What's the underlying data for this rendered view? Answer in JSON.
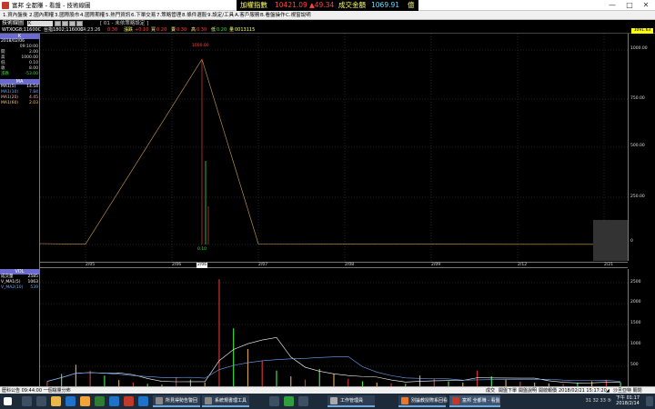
{
  "window": {
    "title": "富邦 全都賺 - 看盤 - 技術線圖",
    "controls": [
      "—",
      "□",
      "✕"
    ]
  },
  "ticker": {
    "index_label": "加權指數",
    "index_value": "10421.09",
    "change": "▲49.34",
    "turnover_label": "成交金額",
    "turnover_value": "1069.91",
    "unit": "億"
  },
  "menu": [
    "1.資內盤後",
    "2.國內期權",
    "3.國際股市",
    "4.國際期權",
    "5.熱門資訊",
    "6.下單交易",
    "7.策略管理",
    "8.條件選股",
    "9.設定/工具",
    "A.客戶服務",
    "B.看盤操作",
    "C.視窗說明"
  ],
  "toolbar": {
    "label": "技術線圖",
    "combo": "K",
    "strategy": "[ 01 - 未依策略設定 ]"
  },
  "infobar": {
    "symbol": "WTXOG8;11600C",
    "name": "台指1802;11600C",
    "time": "04:23:26",
    "price": "0.30",
    "change_label": "漲跌",
    "change": "+0.10",
    "bid_label": "買",
    "bid": "0.20",
    "ask_label": "賣",
    "ask": "0.30",
    "high_label": "高",
    "high": "0.30",
    "low_label": "低",
    "low": "0.20",
    "vol_label": "量",
    "vol": "0013115",
    "price_tag": "1091.63"
  },
  "left_panel": {
    "k_header": "K",
    "date": "2018/02/06",
    "time": "09:10:00",
    "rows": [
      {
        "label": "開",
        "value": "2.00"
      },
      {
        "label": "高",
        "value": "1000.00"
      },
      {
        "label": "低",
        "value": "0.10"
      },
      {
        "label": "收",
        "value": "8.00"
      },
      {
        "label": "漲跌",
        "value": "-53.00"
      }
    ],
    "ma_header": "MA",
    "ma_rows": [
      {
        "label": "MA1(5)",
        "value": "14.54",
        "color": "#ffffff"
      },
      {
        "label": "MA1(10)",
        "value": "7.84",
        "color": "#6fa8ff"
      },
      {
        "label": "MA1(20)",
        "value": "4.45",
        "color": "#ffaaaa"
      },
      {
        "label": "MA1(60)",
        "value": "2.03",
        "color": "#ffcc66"
      }
    ],
    "vol_header": "VOL",
    "vol_rows": [
      {
        "label": "成交量",
        "value": "2585",
        "color": "#ffffff"
      },
      {
        "label": "V_MA1(5)",
        "value": "1063",
        "color": "#ffffff"
      },
      {
        "label": "V_MA2(10)",
        "value": "539",
        "color": "#6fa8ff"
      }
    ]
  },
  "main_axis": [
    "1000.00",
    "750.00",
    "500.00",
    "250.00",
    "0"
  ],
  "spike_label": "1000.00",
  "low_label": "0.10",
  "dates": [
    "2/05",
    "2/06",
    "2/06",
    "2/07",
    "2/08",
    "2/09",
    "2/12",
    "2/21"
  ],
  "vol_axis": [
    "2500",
    "2000",
    "1500",
    "1000",
    "500"
  ],
  "chart_data": [
    {
      "type": "line",
      "title": "",
      "x": [
        "2/05",
        "2/06",
        "2/07",
        "2/08",
        "2/09",
        "2/12",
        "2/21"
      ],
      "ylim": [
        0,
        1050
      ],
      "series": [
        {
          "values": [
            2,
            1000,
            3,
            2,
            2,
            1,
            1
          ]
        }
      ]
    },
    {
      "type": "bar",
      "title": "",
      "ylim": [
        0,
        2700
      ],
      "series": [
        {
          "name": "成交量",
          "values": [
            120,
            300,
            520,
            380,
            260,
            150,
            90,
            60,
            40,
            210,
            160,
            90,
            2585,
            1400,
            900,
            620,
            380,
            240,
            160,
            420,
            300,
            180,
            120,
            90,
            70,
            60,
            260,
            180,
            120,
            90,
            380,
            240,
            160,
            110,
            90,
            70,
            60,
            80,
            120,
            160,
            90
          ]
        }
      ]
    }
  ],
  "status": {
    "left": "歷科公告 09:44:00 一個檔量分佈",
    "right_items": [
      "成交",
      "開盤下單",
      "開盤說明",
      "開啟報價",
      "2018/02/21 15:17:20",
      "◢",
      "沙旦亞特 關閉"
    ]
  },
  "taskbar": {
    "tasks": [
      "所見得勢告警回",
      "系統規書理工具",
      "工作管理員",
      "別論教授際系回看",
      "富邦 全都賺 - 看盤"
    ],
    "clock_time": "下午 01:17",
    "clock_date": "2018/2/14",
    "tray": "31 32 33 ⑤"
  }
}
